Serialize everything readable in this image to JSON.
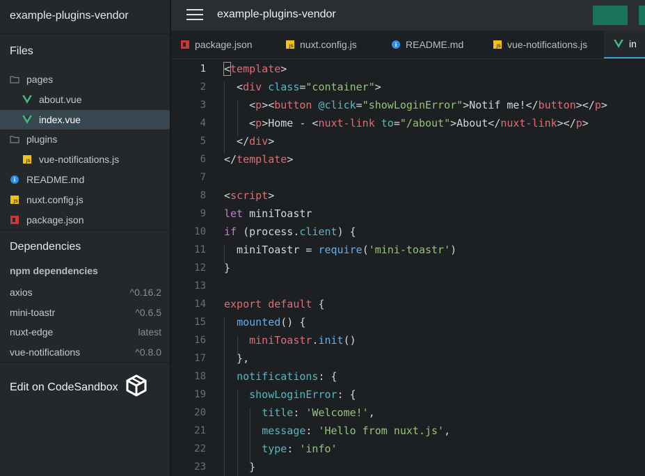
{
  "sidebar": {
    "title": "example-plugins-vendor",
    "files_heading": "Files",
    "files": [
      {
        "label": "pages",
        "icon": "folder-icon",
        "depth": 0,
        "active": false
      },
      {
        "label": "about.vue",
        "icon": "vue-icon",
        "depth": 1,
        "active": false
      },
      {
        "label": "index.vue",
        "icon": "vue-icon",
        "depth": 1,
        "active": true
      },
      {
        "label": "plugins",
        "icon": "folder-icon",
        "depth": 0,
        "active": false
      },
      {
        "label": "vue-notifications.js",
        "icon": "js-icon",
        "depth": 1,
        "active": false
      },
      {
        "label": "README.md",
        "icon": "info-icon",
        "depth": 0,
        "active": false
      },
      {
        "label": "nuxt.config.js",
        "icon": "js-icon",
        "depth": 0,
        "active": false
      },
      {
        "label": "package.json",
        "icon": "npm-icon",
        "depth": 0,
        "active": false
      }
    ],
    "dependencies_heading": "Dependencies",
    "npm_heading": "npm dependencies",
    "dependencies": [
      {
        "name": "axios",
        "version": "^0.16.2"
      },
      {
        "name": "mini-toastr",
        "version": "^0.6.5"
      },
      {
        "name": "nuxt-edge",
        "version": "latest"
      },
      {
        "name": "vue-notifications",
        "version": "^0.8.0"
      }
    ],
    "edit_link": "Edit on CodeSandbox"
  },
  "topbar": {
    "title": "example-plugins-vendor",
    "button_color": "#19735a"
  },
  "tabs": [
    {
      "label": "package.json",
      "icon": "npm-icon",
      "active": false
    },
    {
      "label": "nuxt.config.js",
      "icon": "js-icon",
      "active": false
    },
    {
      "label": "README.md",
      "icon": "info-icon",
      "active": false
    },
    {
      "label": "vue-notifications.js",
      "icon": "js-icon",
      "active": false
    },
    {
      "label": "in",
      "icon": "vue-icon",
      "active": true
    }
  ],
  "editor": {
    "current_line": 1,
    "lines": [
      "<template>",
      "  <div class=\"container\">",
      "    <p><button @click=\"showLoginError\">Notif me!</button></p>",
      "    <p>Home - <nuxt-link to=\"/about\">About</nuxt-link></p>",
      "  </div>",
      "</template>",
      "",
      "<script>",
      "let miniToastr",
      "if (process.client) {",
      "  miniToastr = require('mini-toastr')",
      "}",
      "",
      "export default {",
      "  mounted() {",
      "    miniToastr.init()",
      "  },",
      "  notifications: {",
      "    showLoginError: {",
      "      title: 'Welcome!',",
      "      message: 'Hello from nuxt.js',",
      "      type: 'info'",
      "    }"
    ]
  },
  "colors": {
    "accent": "#3aa1d8",
    "vue_green": "#41b883",
    "js_yellow": "#f1c40f",
    "npm_red": "#cb3837"
  }
}
